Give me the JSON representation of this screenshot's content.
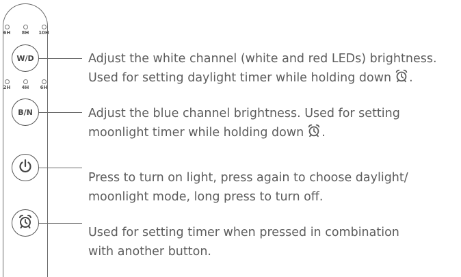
{
  "remote": {
    "white_timer_labels": [
      "6H",
      "8H",
      "10H"
    ],
    "blue_timer_labels": [
      "2H",
      "4H",
      "6H"
    ],
    "buttons": {
      "wd_label": "W/D",
      "bn_label": "B/N"
    }
  },
  "descriptions": {
    "wd": {
      "line1": "Adjust the white channel (white and red LEDs) brightness.",
      "line2_prefix": "Used for setting daylight timer while holding down",
      "line2_suffix": "."
    },
    "bn": {
      "line1": "Adjust the blue channel brightness. Used for setting",
      "line2_prefix": "moonlight  timer while holding down",
      "line2_suffix": "."
    },
    "power": {
      "line1": "Press to turn on light, press again to choose daylight/",
      "line2": "moonlight  mode, long press to turn off."
    },
    "timer": {
      "line1": "Used for setting timer when pressed in combination",
      "line2": "with another button."
    }
  },
  "icons": {
    "power": "power-icon",
    "alarm": "alarm-clock-icon"
  },
  "colors": {
    "outline": "#555555",
    "text": "#5c5c5c"
  }
}
